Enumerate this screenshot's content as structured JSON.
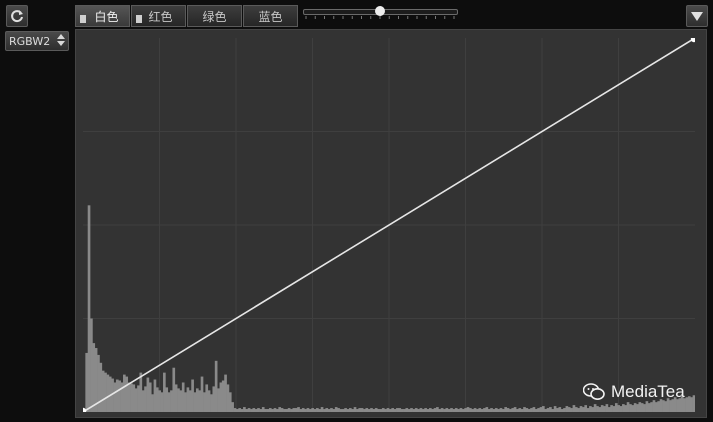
{
  "toolbar": {
    "refresh_icon": "refresh-icon",
    "tabs": [
      {
        "label": "白色",
        "active": true,
        "checkbox": true
      },
      {
        "label": "红色",
        "active": false,
        "checkbox": true
      },
      {
        "label": "绿色",
        "active": false,
        "checkbox": false
      },
      {
        "label": "蓝色",
        "active": false,
        "checkbox": false
      }
    ],
    "slider_value": 0.5,
    "menu_icon": "triangle-down-icon"
  },
  "preset": {
    "value": "RGBW2"
  },
  "curve": {
    "points": [
      [
        0,
        0
      ],
      [
        255,
        255
      ]
    ],
    "line_color": "#e6e6e6",
    "grid": true
  },
  "histogram": {
    "bins": [
      0,
      60,
      210,
      95,
      70,
      65,
      58,
      50,
      42,
      40,
      38,
      36,
      34,
      30,
      33,
      32,
      30,
      38,
      36,
      30,
      29,
      28,
      24,
      27,
      40,
      22,
      26,
      35,
      30,
      18,
      33,
      25,
      22,
      20,
      40,
      25,
      20,
      22,
      45,
      28,
      24,
      22,
      30,
      20,
      25,
      22,
      33,
      20,
      24,
      22,
      36,
      20,
      28,
      22,
      18,
      26,
      52,
      24,
      30,
      32,
      38,
      28,
      20,
      10,
      4,
      3,
      4,
      3,
      5,
      3,
      4,
      3,
      4,
      3,
      4,
      3,
      5,
      3,
      3,
      4,
      3,
      4,
      3,
      5,
      4,
      3,
      3,
      4,
      3,
      4,
      4,
      5,
      3,
      4,
      3,
      4,
      3,
      4,
      3,
      4,
      3,
      5,
      3,
      4,
      3,
      4,
      3,
      5,
      4,
      3,
      3,
      4,
      3,
      4,
      3,
      5,
      3,
      4,
      4,
      3,
      4,
      3,
      4,
      3,
      4,
      3,
      3,
      4,
      3,
      4,
      3,
      4,
      3,
      4,
      4,
      3,
      3,
      4,
      3,
      4,
      3,
      4,
      3,
      4,
      3,
      4,
      3,
      4,
      3,
      4,
      5,
      3,
      4,
      3,
      4,
      3,
      4,
      3,
      4,
      3,
      4,
      3,
      4,
      5,
      4,
      3,
      4,
      3,
      4,
      3,
      4,
      5,
      3,
      4,
      3,
      4,
      3,
      4,
      3,
      5,
      4,
      3,
      4,
      5,
      3,
      4,
      3,
      5,
      4,
      3,
      4,
      5,
      3,
      4,
      5,
      6,
      3,
      4,
      5,
      3,
      6,
      4,
      5,
      3,
      4,
      6,
      5,
      4,
      7,
      5,
      4,
      6,
      5,
      7,
      4,
      6,
      5,
      8,
      6,
      5,
      7,
      6,
      8,
      5,
      7,
      6,
      9,
      7,
      6,
      8,
      7,
      10,
      8,
      7,
      9,
      8,
      10,
      9,
      8,
      11,
      9,
      10,
      12,
      10,
      11,
      13,
      12,
      11,
      14,
      12,
      13,
      15,
      13,
      14,
      16,
      14,
      15,
      16,
      15,
      17
    ],
    "max_bin": 380,
    "bar_color": "#8a8a8a"
  },
  "watermark": {
    "text": "MediaTea",
    "icon": "wechat-icon"
  }
}
